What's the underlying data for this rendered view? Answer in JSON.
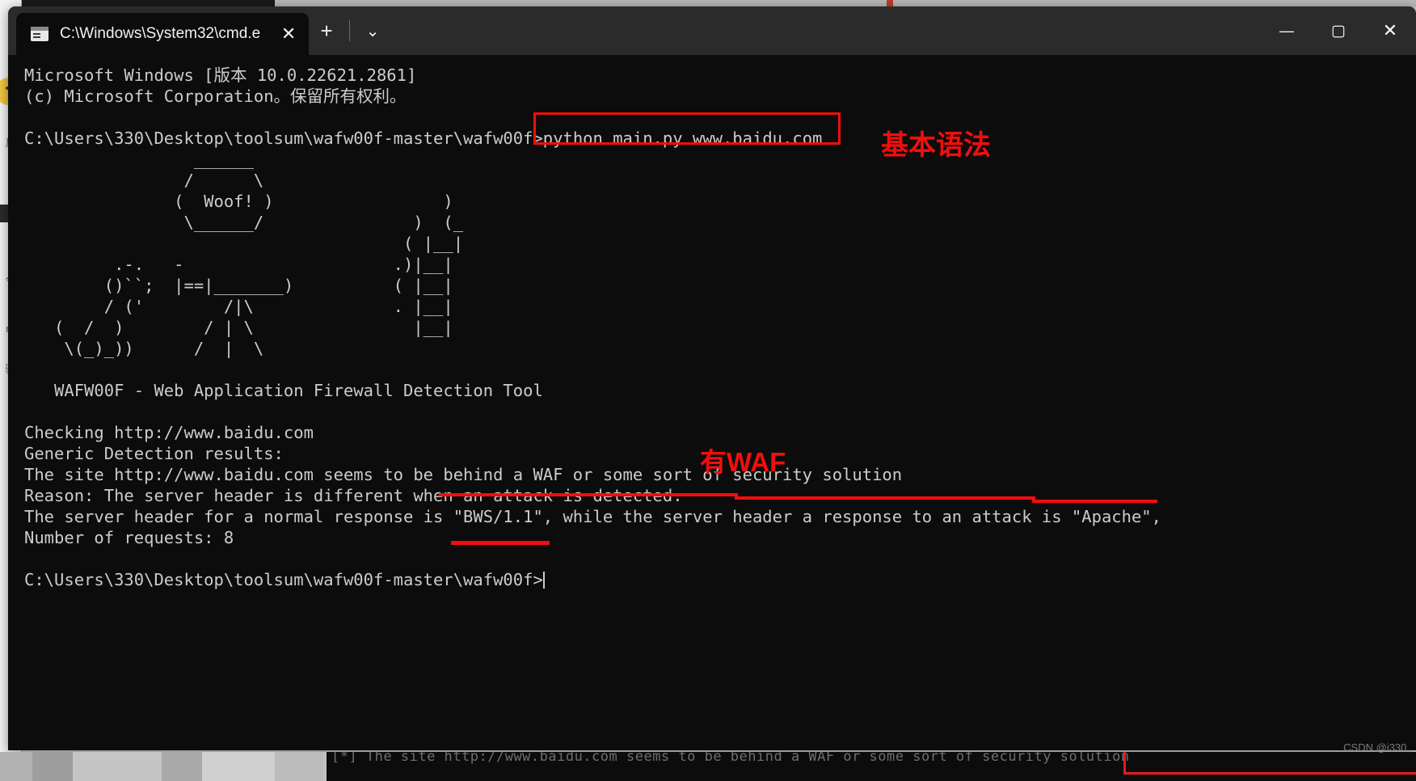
{
  "window": {
    "tab_title": "C:\\Windows\\System32\\cmd.e",
    "tab_icon": "cmd-icon",
    "close_tab_glyph": "✕",
    "new_tab_glyph": "+",
    "dropdown_glyph": "⌄",
    "minimize_glyph": "—",
    "maximize_glyph": "▢",
    "close_glyph": "✕"
  },
  "console": {
    "banner_line_1": "Microsoft Windows [版本 10.0.22621.2861]",
    "banner_line_2": "(c) Microsoft Corporation。保留所有权利。",
    "prompt_path": "C:\\Users\\330\\Desktop\\toolsum\\wafw00f-master\\wafw00f>",
    "command": "python main.py www.baidu.com",
    "ascii_art": "                 ______\n                /      \\\n               (  Woof! )                 )\n                \\______/               )  (_\n                                      ( |__|\n         .-.   -                     .)|__|\n        ()``;  |==|_______)          ( |__|\n        / ('        /|\\              . |__|\n   (  /  )        / | \\                |__|\n    \\(_)_))      /  |  \\",
    "tool_title": "WAFW00F - Web Application Firewall Detection Tool",
    "output_lines": [
      "Checking http://www.baidu.com",
      "Generic Detection results:",
      "The site http://www.baidu.com seems to be behind a WAF or some sort of security solution",
      "Reason: The server header is different when an attack is detected.",
      "The server header for a normal response is \"BWS/1.1\", while the server header a response to an attack is \"Apache\",",
      "Number of requests: 8"
    ],
    "final_prompt": "C:\\Users\\330\\Desktop\\toolsum\\wafw00f-master\\wafw00f>"
  },
  "annotations": {
    "accent_color": "#f40d0d",
    "label_basic_syntax": "基本语法",
    "label_has_waf": "有WAF",
    "boxed_command": "python main.py www.baidu.com",
    "underlined_phrase": "behind a WAF or some sort of security solution",
    "underlined_header": "\"BWS/1.1\""
  },
  "background": {
    "bottom_console_text": "[*] The site http://www.baidu.com seems to be behind a WAF or some sort of security solution",
    "left_strip_chars": [
      "反",
      "打",
      "今",
      "ra",
      "验"
    ]
  },
  "watermark": {
    "text": "CSDN @i330,"
  }
}
